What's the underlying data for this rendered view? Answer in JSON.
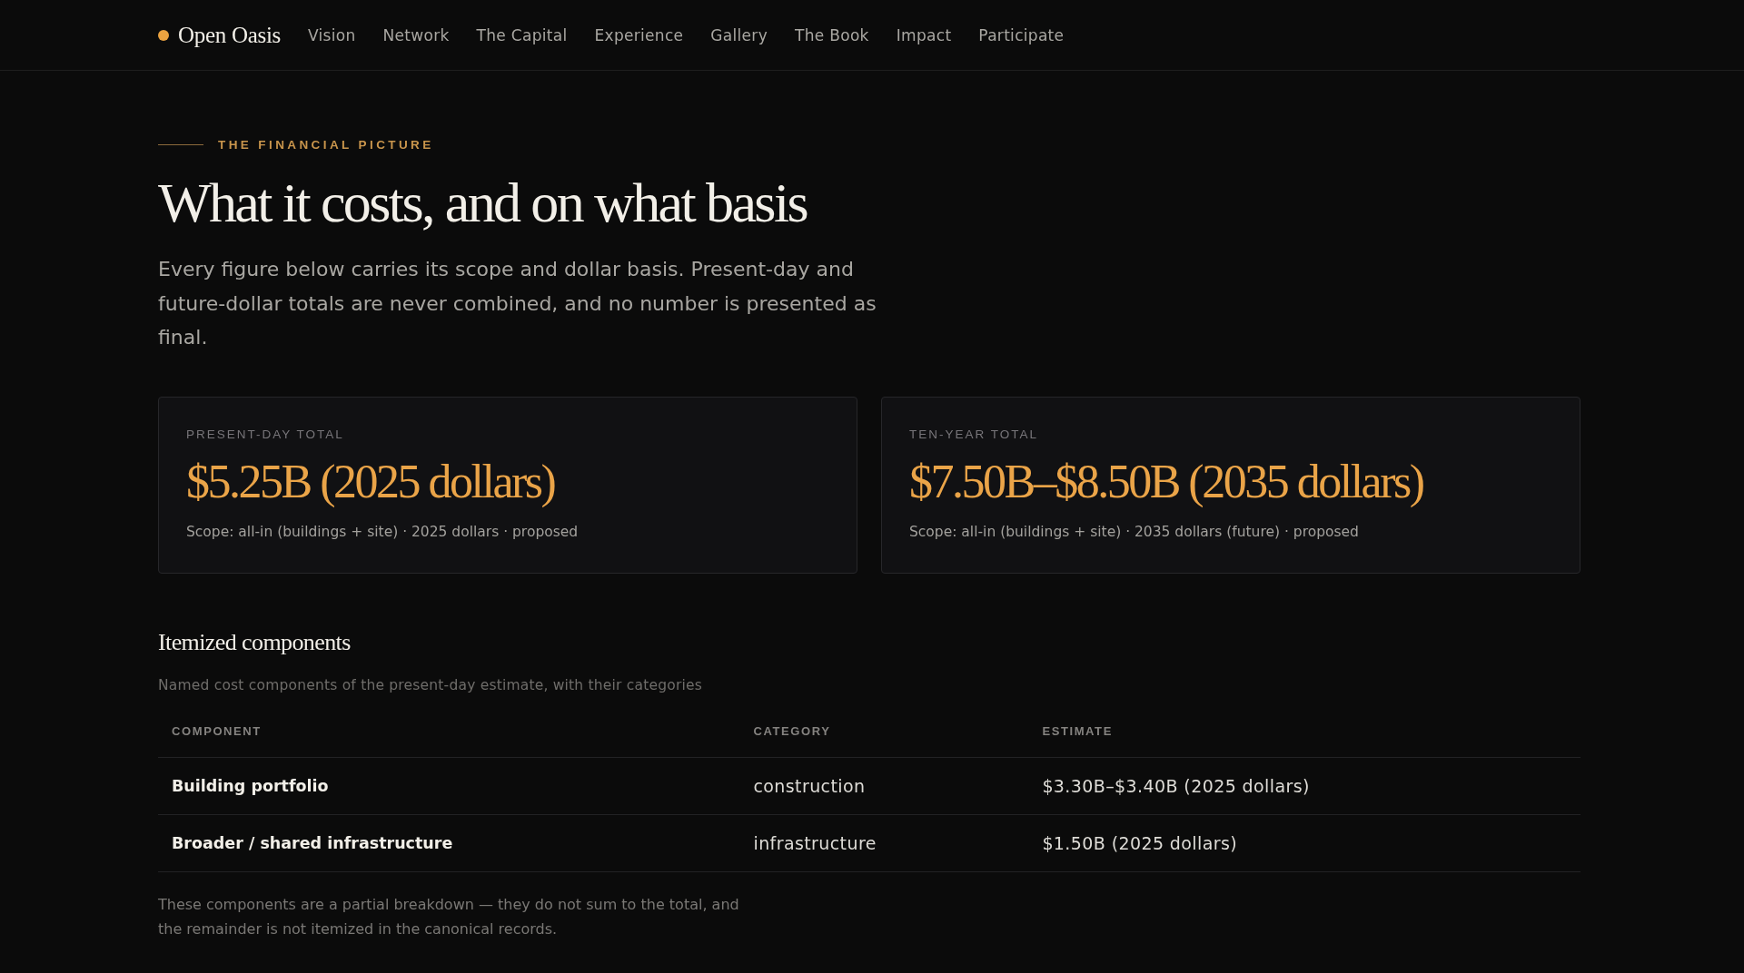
{
  "nav": {
    "brand": "Open Oasis",
    "links": [
      "Vision",
      "Network",
      "The Capital",
      "Experience",
      "Gallery",
      "The Book",
      "Impact",
      "Participate"
    ]
  },
  "section": {
    "eyebrow": "THE FINANCIAL PICTURE",
    "title": "What it costs, and on what basis",
    "intro": "Every figure below carries its scope and dollar basis. Present-day and future-dollar totals are never combined, and no number is presented as final."
  },
  "totals": [
    {
      "label": "PRESENT-DAY TOTAL",
      "value": "$5.25B (2025 dollars)",
      "scope": "Scope: all-in (buildings + site) · 2025 dollars · proposed"
    },
    {
      "label": "TEN-YEAR TOTAL",
      "value": "$7.50B–$8.50B (2035 dollars)",
      "scope": "Scope: all-in (buildings + site) · 2035 dollars (future) · proposed"
    }
  ],
  "itemized": {
    "title": "Itemized components",
    "subtitle": "Named cost components of the present-day estimate, with their categories",
    "table": {
      "columns": [
        "COMPONENT",
        "CATEGORY",
        "ESTIMATE"
      ],
      "rows": [
        [
          "Building portfolio",
          "construction",
          "$3.30B–$3.40B (2025 dollars)"
        ],
        [
          "Broader / shared infrastructure",
          "infrastructure",
          "$1.50B (2025 dollars)"
        ]
      ]
    },
    "footnote": "These components are a partial breakdown — they do not sum to the total, and the remainder is not itemized in the canonical records."
  }
}
